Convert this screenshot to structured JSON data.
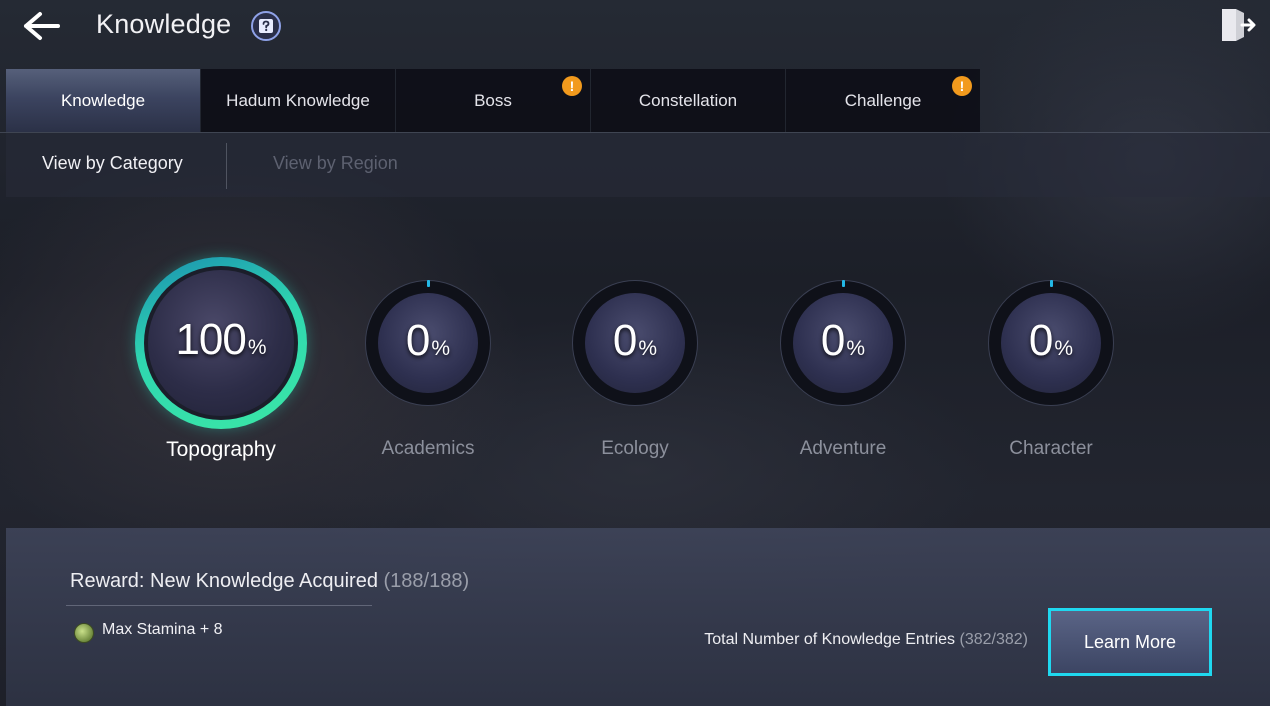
{
  "header": {
    "title": "Knowledge"
  },
  "tabs": [
    {
      "label": "Knowledge",
      "active": true,
      "alert": false
    },
    {
      "label": "Hadum Knowledge",
      "active": false,
      "alert": false
    },
    {
      "label": "Boss",
      "active": false,
      "alert": true
    },
    {
      "label": "Constellation",
      "active": false,
      "alert": false
    },
    {
      "label": "Challenge",
      "active": false,
      "alert": true
    }
  ],
  "alert_glyph": "!",
  "subtabs": {
    "category_label": "View by Category",
    "region_label": "View by Region"
  },
  "categories": [
    {
      "label": "Topography",
      "percent": "100",
      "progress": 1.0,
      "active": true
    },
    {
      "label": "Academics",
      "percent": "0",
      "progress": 0.0,
      "active": false
    },
    {
      "label": "Ecology",
      "percent": "0",
      "progress": 0.0,
      "active": false
    },
    {
      "label": "Adventure",
      "percent": "0",
      "progress": 0.0,
      "active": false
    },
    {
      "label": "Character",
      "percent": "0",
      "progress": 0.0,
      "active": false
    }
  ],
  "percent_unit": "%",
  "reward": {
    "title": "Reward: New Knowledge Acquired",
    "count": "(188/188)",
    "item": "Max Stamina + 8"
  },
  "total": {
    "label": "Total Number of Knowledge Entries",
    "count": "(382/382)"
  },
  "learn_more_label": "Learn More",
  "colors": {
    "accent_cyan": "#1fd8f0",
    "ring_complete": "#2fd6b0",
    "alert_orange": "#f29a1d"
  }
}
